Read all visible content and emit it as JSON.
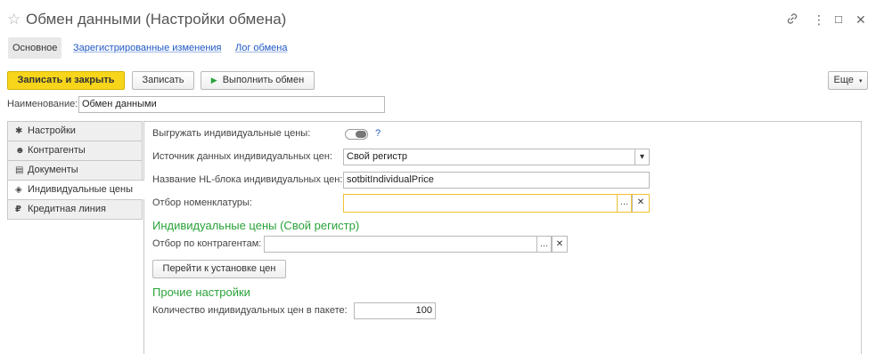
{
  "window": {
    "title": "Обмен данными (Настройки обмена)"
  },
  "nav": {
    "tabs": [
      {
        "label": "Основное"
      },
      {
        "label": "Зарегистрированные изменения"
      },
      {
        "label": "Лог обмена"
      }
    ]
  },
  "toolbar": {
    "save_close_label": "Записать и закрыть",
    "save_label": "Записать",
    "run_exchange_label": "Выполнить обмен",
    "more_label": "Еще"
  },
  "name_field": {
    "label": "Наименование:",
    "value": "Обмен данными"
  },
  "sidebar": {
    "items": [
      {
        "label": "Настройки",
        "icon": "gear-icon"
      },
      {
        "label": "Контрагенты",
        "icon": "users-icon"
      },
      {
        "label": "Документы",
        "icon": "document-icon"
      },
      {
        "label": "Индивидуальные цены",
        "icon": "price-tag-icon"
      },
      {
        "label": "Кредитная линия",
        "icon": "ruble-icon"
      }
    ]
  },
  "main": {
    "export_prices_label": "Выгружать индивидуальные цены:",
    "help_label": "?",
    "source_label": "Источник данных индивидуальных цен:",
    "source_value": "Свой регистр",
    "hl_block_label": "Название HL-блока индивидуальных цен:",
    "hl_block_value": "sotbitIndividualPrice",
    "nomenclature_filter_label": "Отбор номенклатуры:",
    "nomenclature_filter_value": "",
    "section1_title": "Индивидуальные цены (Свой регистр)",
    "contractor_filter_label": "Отбор по контрагентам:",
    "contractor_filter_value": "",
    "goto_prices_label": "Перейти к установке цен",
    "section2_title": "Прочие настройки",
    "batch_label": "Количество индивидуальных цен в пакете:",
    "batch_value": "100"
  },
  "colors": {
    "primary_button": "#f6d51b",
    "section_title": "#2aa33a",
    "link": "#1f58c4",
    "focus_border": "#f0c232"
  }
}
